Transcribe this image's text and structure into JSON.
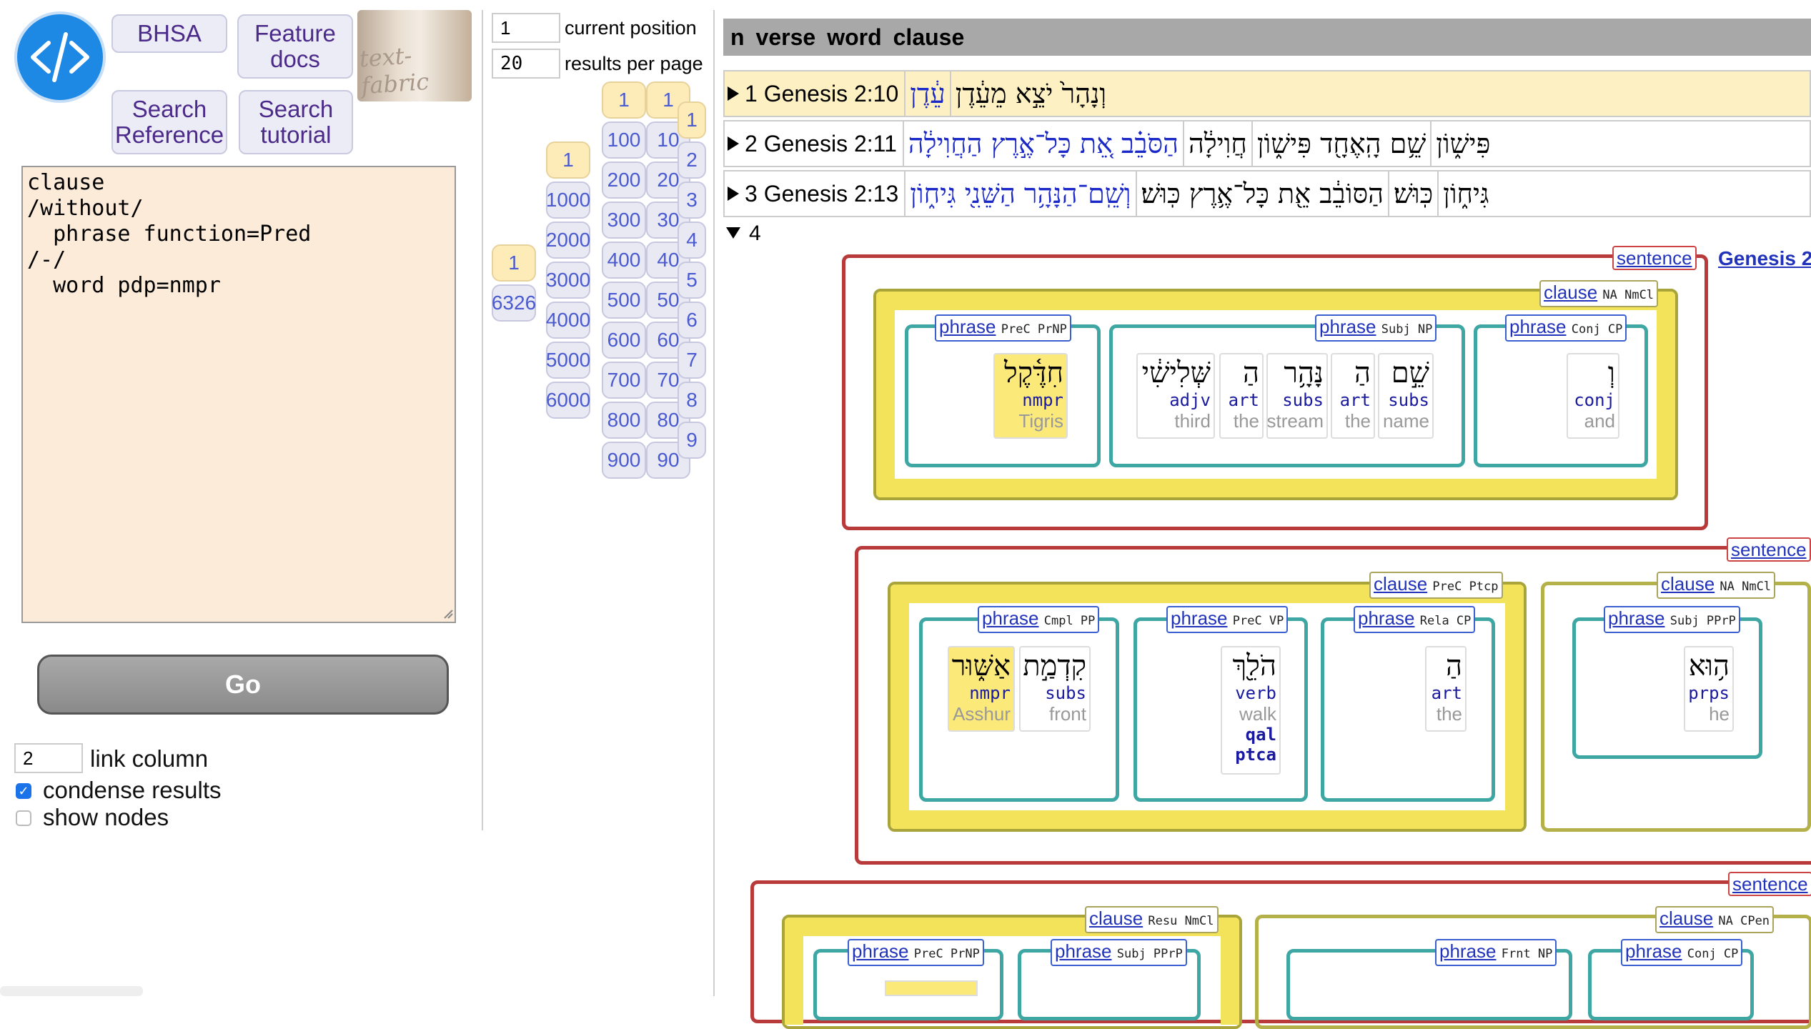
{
  "toolbar": {
    "bhsa": "BHSA",
    "feature_docs_1": "Feature",
    "feature_docs_2": "docs",
    "search_ref_1": "Search",
    "search_ref_2": "Reference",
    "search_tut_1": "Search",
    "search_tut_2": "tutorial",
    "tf_logo_text": "text-fabric"
  },
  "query": "clause\n/without/\n  phrase function=Pred\n/-/\n  word pdp=nmpr",
  "go_label": "Go",
  "options": {
    "link_column_value": "2",
    "link_column_label": "link column",
    "condense_label": "condense results",
    "show_nodes_label": "show nodes"
  },
  "pager": {
    "position_value": "1",
    "position_label": "current position",
    "per_page_value": "20",
    "per_page_label": "results per page",
    "col_total": [
      "1",
      "6326"
    ],
    "col_thousands": [
      "1",
      "1000",
      "2000",
      "3000",
      "4000",
      "5000",
      "6000"
    ],
    "col_hundreds": [
      "1",
      "100",
      "200",
      "300",
      "400",
      "500",
      "600",
      "700",
      "800",
      "900"
    ],
    "col_tens": [
      "1",
      "10",
      "20",
      "30",
      "40",
      "50",
      "60",
      "70",
      "80",
      "90"
    ],
    "col_units": [
      "1",
      "2",
      "3",
      "4",
      "5",
      "6",
      "7",
      "8",
      "9"
    ]
  },
  "results": {
    "headers": [
      "n",
      "verse",
      "word",
      "clause"
    ],
    "rows": [
      {
        "ref": "1 Genesis 2:10",
        "word": "עֵ֔דֶן",
        "clause": "וְנָהָר֙ יֹצֵ֣א מֵעֵ֔דֶן"
      },
      {
        "ref": "2 Genesis 2:11",
        "word": "הַחֲוִילָ֔ה",
        "clause": "הַסֹּבֵ֗ב אֵ֚ת כָּל־אֶ֣רֶץ הַחֲוִילָ֔ה",
        "extra": [
          "חֲוִילָ֔ה",
          "שֵׁ֥ם הָֽאֶחָ֖ד פִּישׁ֑וֹן",
          "פִּישׁ֑וֹן"
        ]
      },
      {
        "ref": "3 Genesis 2:13",
        "word": "גִּיח֑וֹן",
        "clause": "וְשֵֽׁם־הַנָּהָ֥ר הַשֵּׁנִ֖י גִּיח֑וֹן",
        "extra": [
          "הַסּוֹבֵ֔ב אֵ֖ת כָּל־אֶ֥רֶץ כּֽוּשׁ׃",
          "כּֽוּשׁ׃",
          "גִּיח֑וֹן"
        ]
      }
    ],
    "expanded_n": "4",
    "genesis_link": "Genesis 2",
    "s1": {
      "sentence": "sentence",
      "clause": {
        "label": "clause",
        "feat": "NA NmCl"
      },
      "phrases": [
        {
          "label": "phrase",
          "feat": "PreC PrNP"
        },
        {
          "label": "phrase",
          "feat": "Subj NP"
        },
        {
          "label": "phrase",
          "feat": "Conj CP"
        }
      ],
      "words": [
        {
          "h": "חִדֶּ֫קֶל",
          "p": "nmpr",
          "g": "Tigris"
        },
        {
          "h": "שְּׁלִישִׁ֔י",
          "p": "adjv",
          "g": "third"
        },
        {
          "h": "הַ",
          "p": "art",
          "g": "the"
        },
        {
          "h": "נָּהָ֥ר",
          "p": "subs",
          "g": "stream"
        },
        {
          "h": "הַ",
          "p": "art",
          "g": "the"
        },
        {
          "h": "שֵׁ֣ם",
          "p": "subs",
          "g": "name"
        },
        {
          "h": "וְ",
          "p": "conj",
          "g": "and"
        }
      ]
    },
    "s2": {
      "sentence": "sentence",
      "clause1": {
        "label": "clause",
        "feat": "PreC Ptcp"
      },
      "clause2": {
        "label": "clause",
        "feat": "NA NmCl"
      },
      "phrases": [
        {
          "label": "phrase",
          "feat": "Cmpl PP"
        },
        {
          "label": "phrase",
          "feat": "PreC VP"
        },
        {
          "label": "phrase",
          "feat": "Rela CP"
        },
        {
          "label": "phrase",
          "feat": "Subj PPrP"
        }
      ],
      "words": [
        {
          "h": "אַשּׁ֑וּר",
          "p": "nmpr",
          "g": "Asshur"
        },
        {
          "h": "קִדְמַ֣ת",
          "p": "subs",
          "g": "front"
        },
        {
          "h": "הֹלֵ֖ךְ",
          "p": "verb",
          "g": "walk",
          "x1": "qal",
          "x2": "ptca"
        },
        {
          "h": "הַ",
          "p": "art",
          "g": "the"
        },
        {
          "h": "ה֥וּא",
          "p": "prps",
          "g": "he"
        }
      ]
    },
    "s3": {
      "sentence": "sentence",
      "clause1": {
        "label": "clause",
        "feat": "Resu NmCl"
      },
      "clause2": {
        "label": "clause",
        "feat": "NA CPen"
      },
      "phrases": [
        {
          "label": "phrase",
          "feat": "PreC PrNP"
        },
        {
          "label": "phrase",
          "feat": "Subj PPrP"
        },
        {
          "label": "phrase",
          "feat": "Frnt NP"
        },
        {
          "label": "phrase",
          "feat": "Conj CP"
        }
      ]
    }
  }
}
